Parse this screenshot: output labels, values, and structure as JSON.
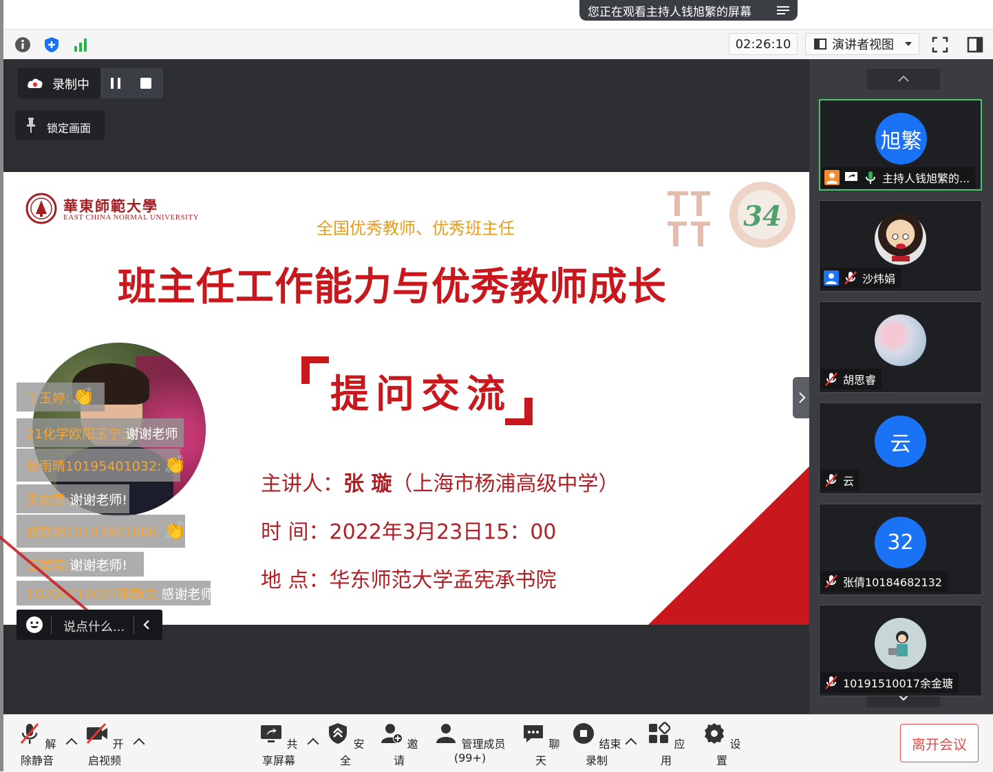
{
  "banner": {
    "text": "您正在观看主持人钱旭繁的屏幕"
  },
  "toolbar": {
    "timer": "02:26:10",
    "view_label": "演讲者视图"
  },
  "recording": {
    "label": "录制中"
  },
  "lock": {
    "label": "锁定画面"
  },
  "slide": {
    "logo_cn": "華東師範大學",
    "logo_en": "EAST CHINA NORMAL UNIVERSITY",
    "subtitle": "全国优秀教师、优秀班主任",
    "title": "班主任工作能力与优秀教师成长",
    "qa_title": "提问交流",
    "speaker_label": "主讲人：",
    "speaker_name": "张 璇",
    "speaker_org": "（上海市杨浦高级中学）",
    "time_label": "时 间：",
    "time_value": "2022年3月23日15：00",
    "place_label": "地 点：",
    "place_value": "华东师范大学孟宪承书院"
  },
  "chat": {
    "messages": [
      {
        "name": "丁玉婷:",
        "text": "",
        "clap": true
      },
      {
        "name": "21化学欧阳玉宁:",
        "text": "谢谢老师",
        "clap": false
      },
      {
        "name": "张雨晴10195401032:",
        "text": "",
        "clap": true
      },
      {
        "name": "吴俞霏:",
        "text": "谢谢老师!",
        "clap": false
      },
      {
        "name": "魏歆玥10193901006:",
        "text": "",
        "clap": true
      },
      {
        "name": "王婧奕:",
        "text": "谢谢老师!",
        "clap": false
      },
      {
        "name": "10200710037李静文:",
        "text": "感谢老师",
        "clap": false
      }
    ],
    "input_placeholder": "说点什么..."
  },
  "gallery": {
    "participants": [
      {
        "avatar_text": "旭繁",
        "name": "主持人钱旭繁的...",
        "avatar_color": "#1a73f5"
      },
      {
        "avatar_text": "",
        "name": "沙炜娟",
        "avatar_color": "#d8d8d8"
      },
      {
        "avatar_text": "",
        "name": "胡思睿",
        "avatar_color": "#e8e8ee"
      },
      {
        "avatar_text": "云",
        "name": "云",
        "avatar_color": "#1a73f5"
      },
      {
        "avatar_text": "32",
        "name": "张倩10184682132",
        "avatar_color": "#1a73f5"
      },
      {
        "avatar_text": "",
        "name": "10191510017余金瑭",
        "avatar_color": "#c9d6d6"
      }
    ]
  },
  "bottom": {
    "unmute": "解除静音",
    "video": "开启视频",
    "share": "共享屏幕",
    "security": "安全",
    "invite": "邀请",
    "members": "管理成员(99+)",
    "chat": "聊天",
    "end_record": "结束录制",
    "apps": "应用",
    "settings": "设置",
    "leave": "离开会议"
  }
}
